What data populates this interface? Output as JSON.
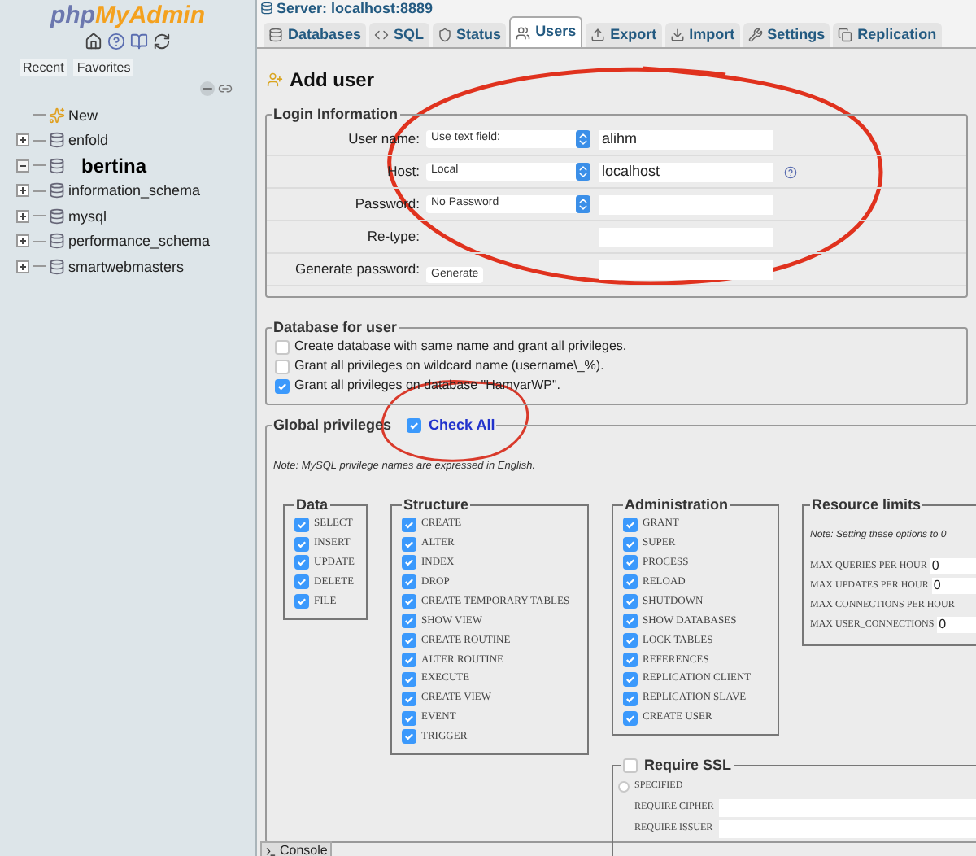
{
  "sidebar": {
    "logo": {
      "part_1": "php",
      "part_2": "MyAdmin"
    },
    "tabs": [
      "Recent",
      "Favorites"
    ],
    "tree": [
      {
        "label": "New",
        "kind": "new",
        "selected": false
      },
      {
        "label": "enfold",
        "kind": "db",
        "expanded": false,
        "selected": false
      },
      {
        "label": "bertina",
        "kind": "db",
        "expanded": true,
        "selected": true
      },
      {
        "label": "information_schema",
        "kind": "db",
        "expanded": false,
        "selected": false
      },
      {
        "label": "mysql",
        "kind": "db",
        "expanded": false,
        "selected": false
      },
      {
        "label": "performance_schema",
        "kind": "db",
        "expanded": false,
        "selected": false
      },
      {
        "label": "smartwebmasters",
        "kind": "db",
        "expanded": false,
        "selected": false
      }
    ]
  },
  "server": "Server: localhost:8889",
  "tabs": [
    {
      "label": "Databases",
      "selected": false
    },
    {
      "label": "SQL",
      "selected": false
    },
    {
      "label": "Status",
      "selected": false
    },
    {
      "label": "Users",
      "selected": true
    },
    {
      "label": "Export",
      "selected": false
    },
    {
      "label": "Import",
      "selected": false
    },
    {
      "label": "Settings",
      "selected": false
    },
    {
      "label": "Replication",
      "selected": false
    }
  ],
  "heading": "Add user",
  "login": {
    "legend": "Login Information",
    "rows": [
      {
        "kind": "select",
        "label": "User name:",
        "select": "Use text field:",
        "value": "alihm",
        "help": false
      },
      {
        "kind": "select",
        "label": "Host:",
        "select": "Local",
        "value": "localhost",
        "help": true
      },
      {
        "kind": "select",
        "label": "Password:",
        "select": "No Password",
        "help": false
      },
      {
        "kind": "plain",
        "label": "Re-type:",
        "help": false
      },
      {
        "kind": "button",
        "label": "Generate password:",
        "button": "Generate",
        "help": false
      }
    ]
  },
  "database": {
    "legend": "Database for user",
    "options": [
      {
        "label": "Create database with same name and grant all privileges.",
        "checked": false
      },
      {
        "label": "Grant all privileges on wildcard name (username\\_%).",
        "checked": false
      },
      {
        "label": "Grant all privileges on database \"HamyarWP\".",
        "checked": true
      }
    ]
  },
  "global": {
    "legend": "Global privileges",
    "check_all": {
      "label": "Check All",
      "checked": true
    },
    "note": "Note: MySQL privilege names are expressed in English.",
    "groups": [
      {
        "legend": "Data",
        "items": [
          {
            "label": "SELECT",
            "checked": true
          },
          {
            "label": "INSERT",
            "checked": true
          },
          {
            "label": "UPDATE",
            "checked": true
          },
          {
            "label": "DELETE",
            "checked": true
          },
          {
            "label": "FILE",
            "checked": true
          }
        ]
      },
      {
        "legend": "Structure",
        "items": [
          {
            "label": "CREATE",
            "checked": true
          },
          {
            "label": "ALTER",
            "checked": true
          },
          {
            "label": "INDEX",
            "checked": true
          },
          {
            "label": "DROP",
            "checked": true
          },
          {
            "label": "CREATE TEMPORARY TABLES",
            "checked": true
          },
          {
            "label": "SHOW VIEW",
            "checked": true
          },
          {
            "label": "CREATE ROUTINE",
            "checked": true
          },
          {
            "label": "ALTER ROUTINE",
            "checked": true
          },
          {
            "label": "EXECUTE",
            "checked": true
          },
          {
            "label": "CREATE VIEW",
            "checked": true
          },
          {
            "label": "EVENT",
            "checked": true
          },
          {
            "label": "TRIGGER",
            "checked": true
          }
        ]
      },
      {
        "legend": "Administration",
        "items": [
          {
            "label": "GRANT",
            "checked": true
          },
          {
            "label": "SUPER",
            "checked": true
          },
          {
            "label": "PROCESS",
            "checked": true
          },
          {
            "label": "RELOAD",
            "checked": true
          },
          {
            "label": "SHUTDOWN",
            "checked": true
          },
          {
            "label": "SHOW DATABASES",
            "checked": true
          },
          {
            "label": "LOCK TABLES",
            "checked": true
          },
          {
            "label": "REFERENCES",
            "checked": true
          },
          {
            "label": "REPLICATION CLIENT",
            "checked": true
          },
          {
            "label": "REPLICATION SLAVE",
            "checked": true
          },
          {
            "label": "CREATE USER",
            "checked": true
          }
        ]
      }
    ],
    "resource_limits": {
      "legend": "Resource limits",
      "note": "Note: Setting these options to 0",
      "rows": [
        {
          "label": "MAX QUERIES PER HOUR",
          "value": "0"
        },
        {
          "label": "MAX UPDATES PER HOUR",
          "value": "0"
        },
        {
          "label": "MAX CONNECTIONS PER HOUR"
        },
        {
          "label": "MAX USER_CONNECTIONS",
          "value": "0"
        }
      ]
    },
    "ssl": {
      "legend": "Require SSL",
      "checked": false,
      "options": [
        {
          "label": "SPECIFIED",
          "selected": false
        }
      ],
      "fields": [
        "REQUIRE CIPHER",
        "REQUIRE ISSUER"
      ]
    }
  },
  "console": "Console"
}
